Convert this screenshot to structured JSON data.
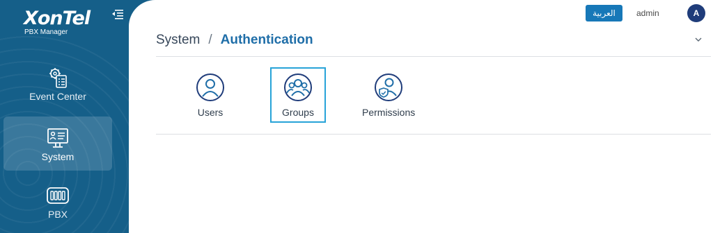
{
  "brand": {
    "name": "XonTel",
    "subtitle": "PBX Manager"
  },
  "sidebar": {
    "items": [
      {
        "label": "Event Center",
        "icon": "event-center-icon",
        "active": false
      },
      {
        "label": "System",
        "icon": "system-icon",
        "active": true
      },
      {
        "label": "PBX",
        "icon": "pbx-icon",
        "active": false
      }
    ]
  },
  "header": {
    "language_button": "العربية",
    "username": "admin",
    "avatar_initial": "A"
  },
  "breadcrumb": {
    "parent": "System",
    "separator": "/",
    "current": "Authentication"
  },
  "tiles": [
    {
      "label": "Users",
      "icon": "user-icon",
      "selected": false
    },
    {
      "label": "Groups",
      "icon": "group-icon",
      "selected": true
    },
    {
      "label": "Permissions",
      "icon": "permissions-icon",
      "selected": false
    }
  ],
  "colors": {
    "sidebar": "#155f89",
    "accent": "#1778b8",
    "title_accent": "#1f6ea8",
    "selected_border": "#27a3d8",
    "avatar": "#1f3c7a"
  }
}
